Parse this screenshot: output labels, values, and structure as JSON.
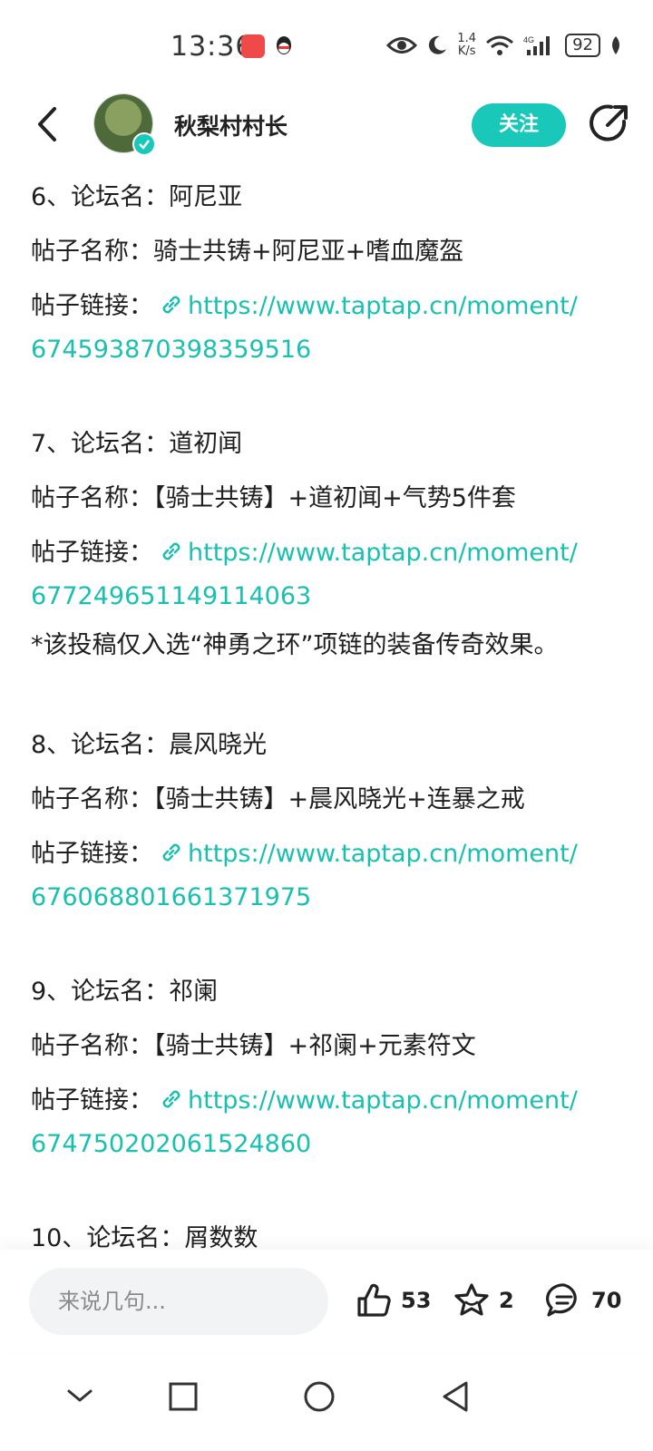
{
  "status_bar": {
    "time": "13:36",
    "network_speed": "1.4\nK/s",
    "battery": "92",
    "icons": [
      "huawei-app-icon",
      "qq-icon",
      "eye-icon",
      "moon-icon",
      "wifi-icon",
      "4g-signal-icon",
      "leaf-icon"
    ]
  },
  "header": {
    "username": "秋梨村村长",
    "follow_label": "关注"
  },
  "entries": [
    {
      "forum_line": "6、论坛名：阿尼亚",
      "title_line": "帖子名称：骑士共铸+阿尼亚+嗜血魔盔",
      "link_label": "帖子链接：",
      "link_part1": "https://www.taptap.cn/moment/",
      "link_part2": "674593870398359516"
    },
    {
      "forum_line": "7、论坛名：道初闻",
      "title_line": "帖子名称：【骑士共铸】+道初闻+气势5件套",
      "link_label": "帖子链接：",
      "link_part1": "https://www.taptap.cn/moment/",
      "link_part2": "677249651149114063",
      "note": "*该投稿仅入选“神勇之环”项链的装备传奇效果。"
    },
    {
      "forum_line": "8、论坛名：晨风晓光",
      "title_line": "帖子名称：【骑士共铸】+晨风晓光+连暴之戒",
      "link_label": "帖子链接：",
      "link_part1": "https://www.taptap.cn/moment/",
      "link_part2": "676068801661371975"
    },
    {
      "forum_line": "9、论坛名：祁阑",
      "title_line": "帖子名称：【骑士共铸】+祁阑+元素符文",
      "link_label": "帖子链接：",
      "link_part1": "https://www.taptap.cn/moment/",
      "link_part2": "674750202061524860"
    }
  ],
  "partial_entry": {
    "forum_line": "10、论坛名：屑数数"
  },
  "bottom_bar": {
    "comment_placeholder": "来说几句...",
    "likes": "53",
    "favorites": "2",
    "comments": "70"
  },
  "colors": {
    "accent": "#19c8b9",
    "link": "#19c0b2",
    "text": "#1e1e1e"
  }
}
